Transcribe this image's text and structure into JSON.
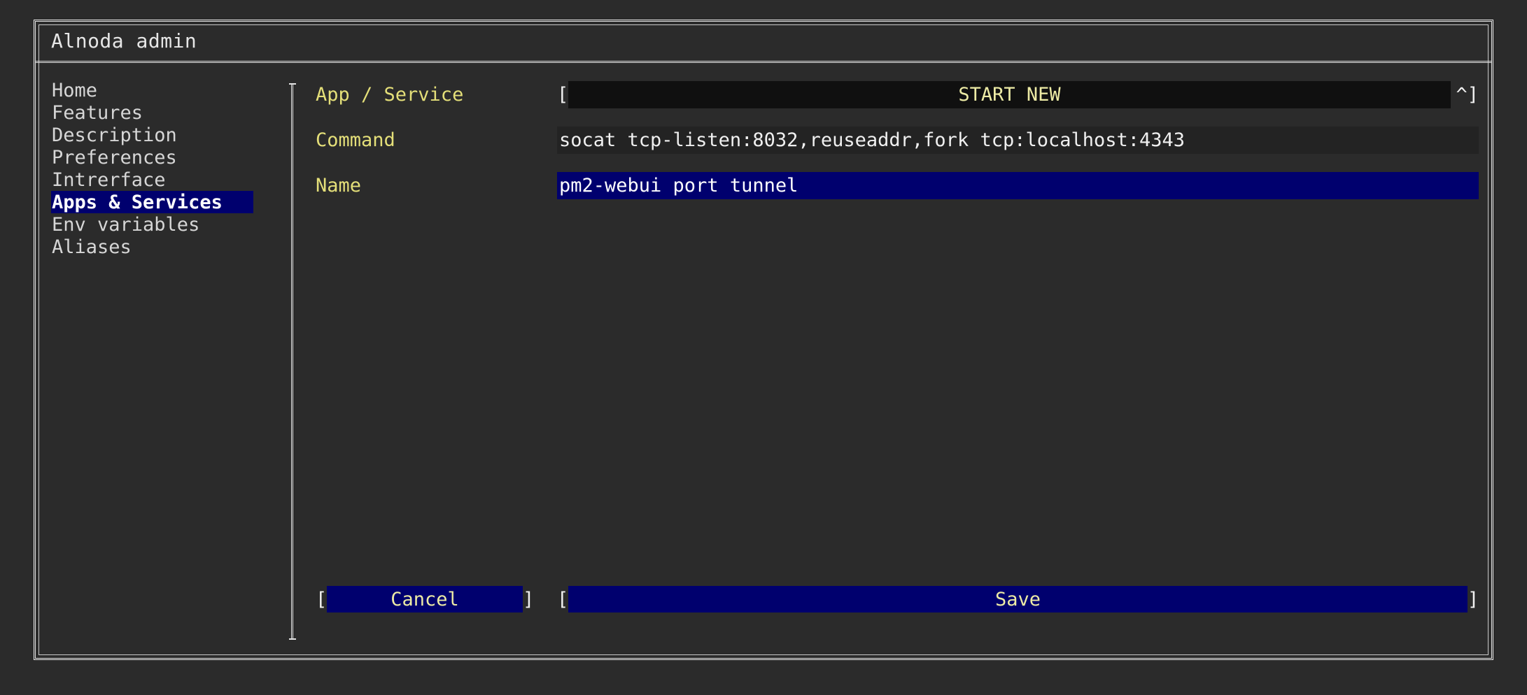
{
  "window": {
    "title": "Alnoda admin"
  },
  "sidebar": {
    "items": [
      {
        "label": "Home",
        "selected": false
      },
      {
        "label": "Features",
        "selected": false
      },
      {
        "label": "Description",
        "selected": false
      },
      {
        "label": "Preferences",
        "selected": false
      },
      {
        "label": "Intrerface",
        "selected": false
      },
      {
        "label": "Apps & Services",
        "selected": true
      },
      {
        "label": "Env variables",
        "selected": false
      },
      {
        "label": "Aliases",
        "selected": false
      }
    ]
  },
  "form": {
    "rows": [
      {
        "label": "App / Service",
        "type": "select",
        "value": "START NEW",
        "left_bracket": "[",
        "right_bracket": "^]",
        "focused": false
      },
      {
        "label": "Command",
        "type": "text",
        "value": "socat tcp-listen:8032,reuseaddr,fork tcp:localhost:4343",
        "placeholder": "",
        "focused": false
      },
      {
        "label": "Name",
        "type": "text",
        "value": "pm2-webui port tunnel",
        "placeholder": "",
        "focused": true
      }
    ]
  },
  "buttons": {
    "cancel": {
      "label": "Cancel",
      "left_bracket": "[",
      "right_bracket": "]"
    },
    "save": {
      "label": "Save",
      "left_bracket": "[",
      "right_bracket": "]"
    }
  },
  "colors": {
    "background": "#2b2b2b",
    "border": "#e3e3e3",
    "label_yellow": "#e4df79",
    "selection_navy": "#00006e",
    "select_background": "#101010",
    "input_background": "#232323",
    "button_text": "#edeba5",
    "text": "#d9d9d9"
  }
}
